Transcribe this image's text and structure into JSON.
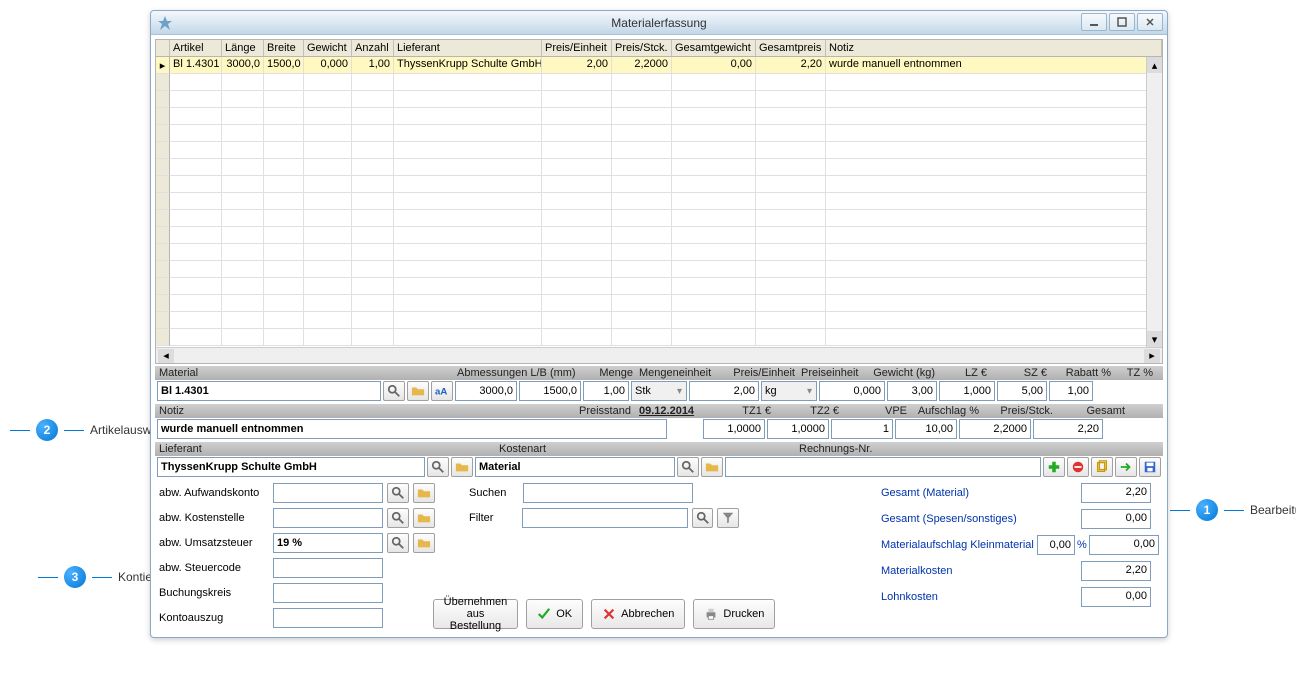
{
  "window": {
    "title": "Materialerfassung"
  },
  "grid": {
    "cols": [
      "Artikel",
      "Länge",
      "Breite",
      "Gewicht",
      "Anzahl",
      "Lieferant",
      "Preis/Einheit",
      "Preis/Stck.",
      "Gesamtgewicht",
      "Gesamtpreis",
      "Notiz"
    ],
    "row": {
      "artikel": "Bl 1.4301",
      "laenge": "3000,0",
      "breite": "1500,0",
      "gewicht": "0,000",
      "anzahl": "1,00",
      "lieferant": "ThyssenKrupp Schulte GmbH",
      "preisEinheit": "2,00",
      "preisStck": "2,2000",
      "gesamtgewicht": "0,00",
      "gesamtpreis": "2,20",
      "notiz": "wurde manuell entnommen"
    }
  },
  "head1": {
    "material": "Material",
    "abm": "Abmessungen L/B (mm)",
    "menge": "Menge",
    "mengeneinheit": "Mengeneinheit",
    "preisEinheit": "Preis/Einheit",
    "preiseinheit": "Preiseinheit",
    "gewicht": "Gewicht (kg)",
    "lz": "LZ €",
    "sz": "SZ €",
    "rabatt": "Rabatt %",
    "tz": "TZ %"
  },
  "line1": {
    "material": "Bl 1.4301",
    "l": "3000,0",
    "b": "1500,0",
    "menge": "1,00",
    "mengeneinheit": "Stk",
    "preisEinheit": "2,00",
    "preiseinheit": "kg",
    "gewicht": "0,000",
    "lz": "3,00",
    "sz": "1,000",
    "rabatt": "5,00",
    "tz": "1,00"
  },
  "head2": {
    "notiz": "Notiz",
    "preisstand": "Preisstand",
    "tz1": "TZ1 €",
    "tz2": "TZ2 €",
    "vpe": "VPE",
    "aufschlag": "Aufschlag %",
    "preisStck": "Preis/Stck.",
    "gesamt": "Gesamt"
  },
  "line2": {
    "notiz": "wurde manuell entnommen",
    "preisstand": "09.12.2014",
    "tz1": "1,0000",
    "tz2": "1,0000",
    "vpe": "1",
    "aufschlag": "10,00",
    "preisStck": "2,2000",
    "gesamt": "2,20"
  },
  "head3": {
    "lieferant": "Lieferant",
    "kostenart": "Kostenart",
    "rechnr": "Rechnungs-Nr."
  },
  "line3": {
    "lieferant": "ThyssenKrupp Schulte GmbH",
    "kostenart": "Material",
    "rechnr": ""
  },
  "konten": {
    "aufwandskonto_lbl": "abw. Aufwandskonto",
    "kostenstelle_lbl": "abw. Kostenstelle",
    "umsatzsteuer_lbl": "abw. Umsatzsteuer",
    "umsatzsteuer_val": "19 %",
    "steuercode_lbl": "abw. Steuercode",
    "buchungskreis_lbl": "Buchungskreis",
    "kontoauszug_lbl": "Kontoauszug"
  },
  "search": {
    "suchen_lbl": "Suchen",
    "filter_lbl": "Filter"
  },
  "totals": {
    "gesamtMaterial_lbl": "Gesamt (Material)",
    "gesamtMaterial_val": "2,20",
    "gesamtSpesen_lbl": "Gesamt (Spesen/sonstiges)",
    "gesamtSpesen_val": "0,00",
    "matAufschlag_lbl": "Materialaufschlag Kleinmaterial",
    "matAufschlag_pct": "0,00",
    "matAufschlag_val": "0,00",
    "materialkosten_lbl": "Materialkosten",
    "materialkosten_val": "2,20",
    "lohnkosten_lbl": "Lohnkosten",
    "lohnkosten_val": "0,00",
    "pct": "%"
  },
  "buttons": {
    "uebernehmen": "Übernehmen aus Bestellung",
    "ok": "OK",
    "abbrechen": "Abbrechen",
    "drucken": "Drucken"
  },
  "callouts": {
    "c1": "Bearbeitung",
    "c2": "Artikelauswahl",
    "c3": "Kontierung"
  }
}
